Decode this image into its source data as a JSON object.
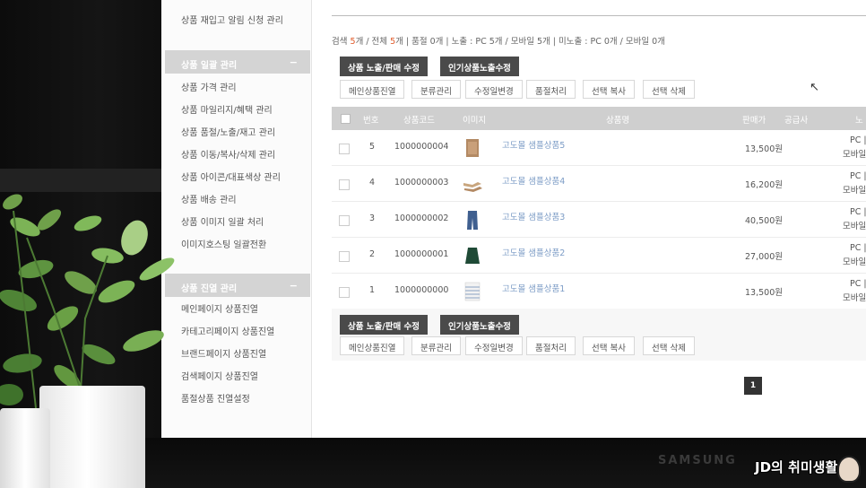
{
  "sidebar": {
    "top_item": "상품 재입고 알림 신청 관리",
    "group1": {
      "title": "상품 일괄 관리",
      "items": [
        "상품 가격 관리",
        "상품 마일리지/혜택 관리",
        "상품 품절/노출/재고 관리",
        "상품 이동/복사/삭제 관리",
        "상품 아이콘/대표색상 관리",
        "상품 배송 관리",
        "상품 이미지 일괄 처리",
        "이미지호스팅 일괄전환"
      ]
    },
    "group2": {
      "title": "상품 진열 관리",
      "items": [
        "메인페이지 상품진열",
        "카테고리페이지 상품진열",
        "브랜드페이지 상품진열",
        "검색페이지 상품진열",
        "품절상품 진열설정"
      ]
    }
  },
  "summary": {
    "search_label": "검색",
    "search_count": "5",
    "search_unit": "개",
    "rest": " / 전체 ",
    "total_count": "5",
    "tail": "개 | 품절 0개 | 노출 : PC 5개 / 모바일 5개 | 미노출 : PC 0개 / 모바일 0개"
  },
  "toolbar": {
    "expose_sale_edit": "상품 노출/판매 수정",
    "popular_expose_edit": "인기상품노출수정",
    "actions": [
      "메인상품진열",
      "분류관리",
      "수정일변경",
      "품절처리",
      "선택 복사",
      "선택 삭제"
    ]
  },
  "table": {
    "headers": [
      "번호",
      "상품코드",
      "이미지",
      "상품명",
      "판매가",
      "공급사",
      "노"
    ],
    "rows": [
      {
        "no": "5",
        "code": "1000000004",
        "name": "고도몰 샘플상품5",
        "price": "13,500원",
        "display": "PC |",
        "display2": "모바일",
        "thumb": "sweater-icon"
      },
      {
        "no": "4",
        "code": "1000000003",
        "name": "고도몰 샘플상품4",
        "price": "16,200원",
        "display": "PC |",
        "display2": "모바일",
        "thumb": "shoes-icon"
      },
      {
        "no": "3",
        "code": "1000000002",
        "name": "고도몰 샘플상품3",
        "price": "40,500원",
        "display": "PC |",
        "display2": "모바일",
        "thumb": "jeans-icon"
      },
      {
        "no": "2",
        "code": "1000000001",
        "name": "고도몰 샘플상품2",
        "price": "27,000원",
        "display": "PC |",
        "display2": "모바일",
        "thumb": "skirt-icon"
      },
      {
        "no": "1",
        "code": "1000000000",
        "name": "고도몰 샘플상품1",
        "price": "13,500원",
        "display": "PC |",
        "display2": "모바일",
        "thumb": "striped-shirt-icon"
      }
    ]
  },
  "pagination": {
    "current": "1"
  },
  "monitor": {
    "brand": "SAMSUNG"
  },
  "watermark": {
    "text": "JD의 취미생활"
  }
}
